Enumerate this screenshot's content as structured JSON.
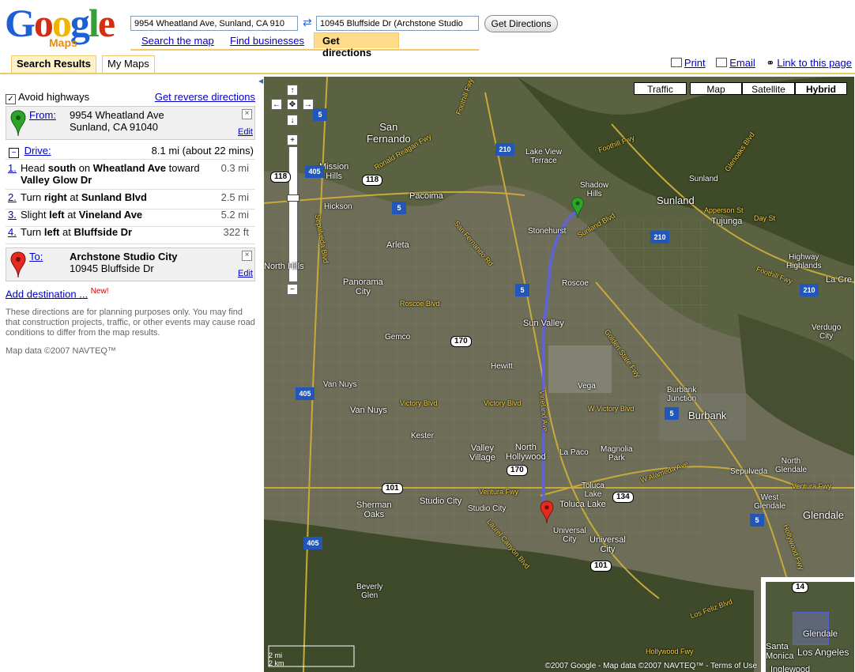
{
  "header": {
    "logo_text": "Google",
    "logo_sub": "Maps",
    "from_value": "9954 Wheatland Ave, Sunland, CA 910",
    "to_value": "10945 Bluffside Dr (Archstone Studio",
    "get_directions": "Get Directions",
    "tabs": [
      "Search the map",
      "Find businesses",
      "Get directions"
    ]
  },
  "subnav": {
    "tabs": [
      "Search Results",
      "My Maps"
    ],
    "print": "Print",
    "email": "Email",
    "link": "Link to this page"
  },
  "directions": {
    "avoid_highways": "Avoid highways",
    "reverse": "Get reverse directions",
    "from_label": "From:",
    "from_line1": "9954 Wheatland Ave",
    "from_line2": "Sunland, CA 91040",
    "edit": "Edit",
    "drive_label": "Drive:",
    "drive_summary": "8.1 mi (about 22 mins)",
    "steps": [
      {
        "num": "1.",
        "pre": "Head ",
        "b1": "south",
        "mid": " on ",
        "b2": "Wheatland Ave",
        "post": " toward ",
        "b3": "Valley Glow Dr",
        "dist": "0.3 mi"
      },
      {
        "num": "2.",
        "pre": "Turn ",
        "b1": "right",
        "mid": " at ",
        "b2": "Sunland Blvd",
        "post": "",
        "b3": "",
        "dist": "2.5 mi"
      },
      {
        "num": "3.",
        "pre": "Slight ",
        "b1": "left",
        "mid": " at ",
        "b2": "Vineland Ave",
        "post": "",
        "b3": "",
        "dist": "5.2 mi"
      },
      {
        "num": "4.",
        "pre": "Turn ",
        "b1": "left",
        "mid": " at ",
        "b2": "Bluffside Dr",
        "post": "",
        "b3": "",
        "dist": "322 ft"
      }
    ],
    "to_label": "To:",
    "to_line1": "Archstone Studio City",
    "to_line2": "10945 Bluffside Dr",
    "add_destination": "Add destination ...",
    "new_badge": "New!",
    "disclaimer": "These directions are for planning purposes only. You may find that construction projects, traffic, or other events may cause road conditions to differ from the map results.",
    "map_data": "Map data ©2007 NAVTEQ™"
  },
  "map": {
    "types": [
      "Traffic",
      "Map",
      "Satellite",
      "Hybrid"
    ],
    "selected_type": "Hybrid",
    "scale_mi": "2 mi",
    "scale_km": "2 km",
    "copyright": "©2007 Google - Map data ©2007 NAVTEQ™ - Terms of Use",
    "labels": {
      "san_fernando": "San\nFernando",
      "mission_hills": "Mission\nHills",
      "lake_view_terrace": "Lake View\nTerrace",
      "shadow_hills": "Shadow\nHills",
      "sunland": "Sunland",
      "sunland2": "Sunland",
      "tujunga": "Tujunga",
      "hickson": "Hickson",
      "pacoima": "Pacoima",
      "arleta": "Arleta",
      "stonehurst": "Stonehurst",
      "roscoe": "Roscoe",
      "panorama_city": "Panorama\nCity",
      "north_hills": "North Hills",
      "sun_valley": "Sun Valley",
      "gemco": "Gemco",
      "hewitt": "Hewitt",
      "vega": "Vega",
      "burbank_junction": "Burbank\nJunction",
      "burbank": "Burbank",
      "van_nuys": "Van Nuys",
      "van_nuys2": "Van Nuys",
      "kester": "Kester",
      "valley_village": "Valley\nVillage",
      "north_hollywood": "North\nHollywood",
      "la_paco": "La Paco",
      "magnolia_park": "Magnolia\nPark",
      "toluca_lake": "Toluca Lake",
      "toluca_lake2": "Toluca\nLake",
      "sherman_oaks": "Sherman\nOaks",
      "studio_city": "Studio City",
      "studio_city2": "Studio City",
      "universal_city": "Universal\nCity",
      "universal_city2": "Universal\nCity",
      "beverly_glen": "Beverly\nGlen",
      "glendale": "Glendale",
      "north_glendale": "North\nGlendale",
      "west_glendale": "West\nGlendale",
      "sepulveda": "Sepulveda",
      "verdugo_city": "Verdugo\nCity",
      "la_crescenta": "La Cre",
      "highway_highlands": "Highway\nHighlands",
      "day_st": "Day St",
      "apperson_st": "Apperson St",
      "foothill_fwy": "Foothill Fwy",
      "foothill_fwy2": "Foothill Fwy",
      "foothill_fwy3": "Foothill Fwy",
      "golden_state_fwy": "Golden State Fwy",
      "roscoe_blvd": "Roscoe Blvd",
      "victory_blvd": "Victory Blvd",
      "victory_blvd2": "Victory Blvd",
      "w_victory_blvd": "W Victory Blvd",
      "ventura_fwy": "Ventura Fwy",
      "ventura_fwy2": "Ventura Fwy",
      "w_alameda_ave": "W Alameda Ave",
      "vineland_ave": "Vineland Ave",
      "sepulveda_blvd": "Sepulveda Blvd",
      "san_fernando_rd": "San Fernando Rd",
      "los_feliz_blvd": "Los Feliz Blvd",
      "hollywood_fwy": "Hollywood Fwy",
      "laurel_canyon_blvd": "Laurel Canyon Blvd",
      "ronald_reagan_fwy": "Ronald Reagan Fwy",
      "glenoaks_blvd": "Glenoaks Blvd",
      "sunland_blvd": "Sunland Blvd",
      "hollywood_fwy2": "Hollywood Fwy"
    },
    "shields": {
      "i5": "5",
      "i405": "405",
      "i210": "210",
      "r118": "118",
      "r170": "170",
      "r101": "101",
      "r134": "134"
    },
    "overview": {
      "glendale": "Glendale",
      "los_angeles": "Los Angeles",
      "santa_monica": "Santa\nMonica",
      "inglewood": "Inglewood",
      "r14": "14"
    }
  },
  "colors": {
    "route": "#5e63d8",
    "tab_accent": "#ffdc8a",
    "start_pin": "#2da52d",
    "end_pin": "#e32b20"
  }
}
